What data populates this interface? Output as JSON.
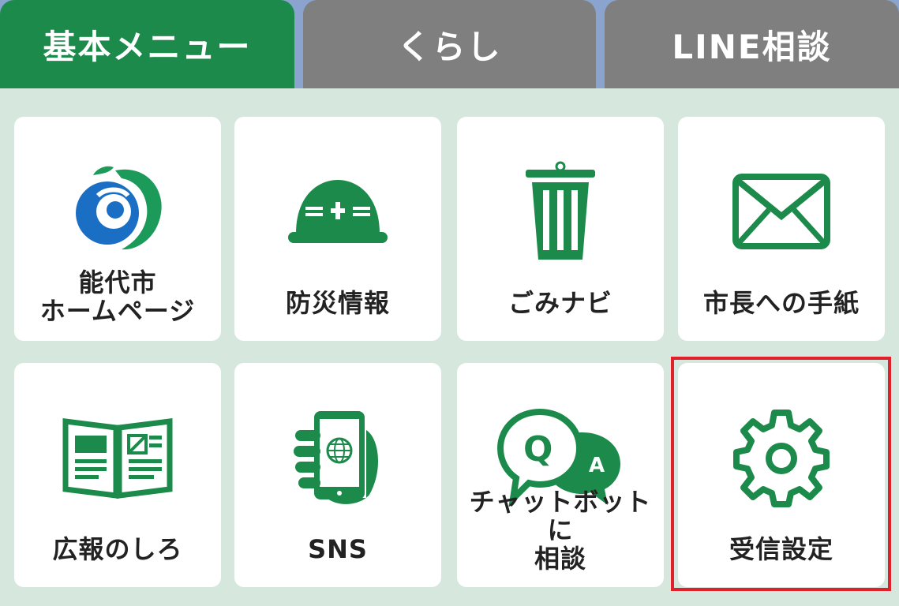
{
  "tabs": [
    {
      "label": "基本メニュー",
      "active": true
    },
    {
      "label": "くらし",
      "active": false
    },
    {
      "label": "LINE相談",
      "active": false
    }
  ],
  "tiles": [
    {
      "label": "能代市\nホームページ",
      "icon": "city-logo-icon"
    },
    {
      "label": "防災情報",
      "icon": "helmet-icon"
    },
    {
      "label": "ごみナビ",
      "icon": "trash-can-icon"
    },
    {
      "label": "市長への手紙",
      "icon": "envelope-icon"
    },
    {
      "label": "広報のしろ",
      "icon": "open-book-icon"
    },
    {
      "label": "SNS",
      "icon": "smartphone-globe-icon"
    },
    {
      "label": "チャットボットに\n相談",
      "icon": "qa-bubbles-icon"
    },
    {
      "label": "受信設定",
      "icon": "gear-icon"
    }
  ],
  "colors": {
    "accent": "#1c8a4a",
    "inactive_tab": "#7f7f7f",
    "background": "#d6e8de",
    "highlight": "#e0202a"
  }
}
